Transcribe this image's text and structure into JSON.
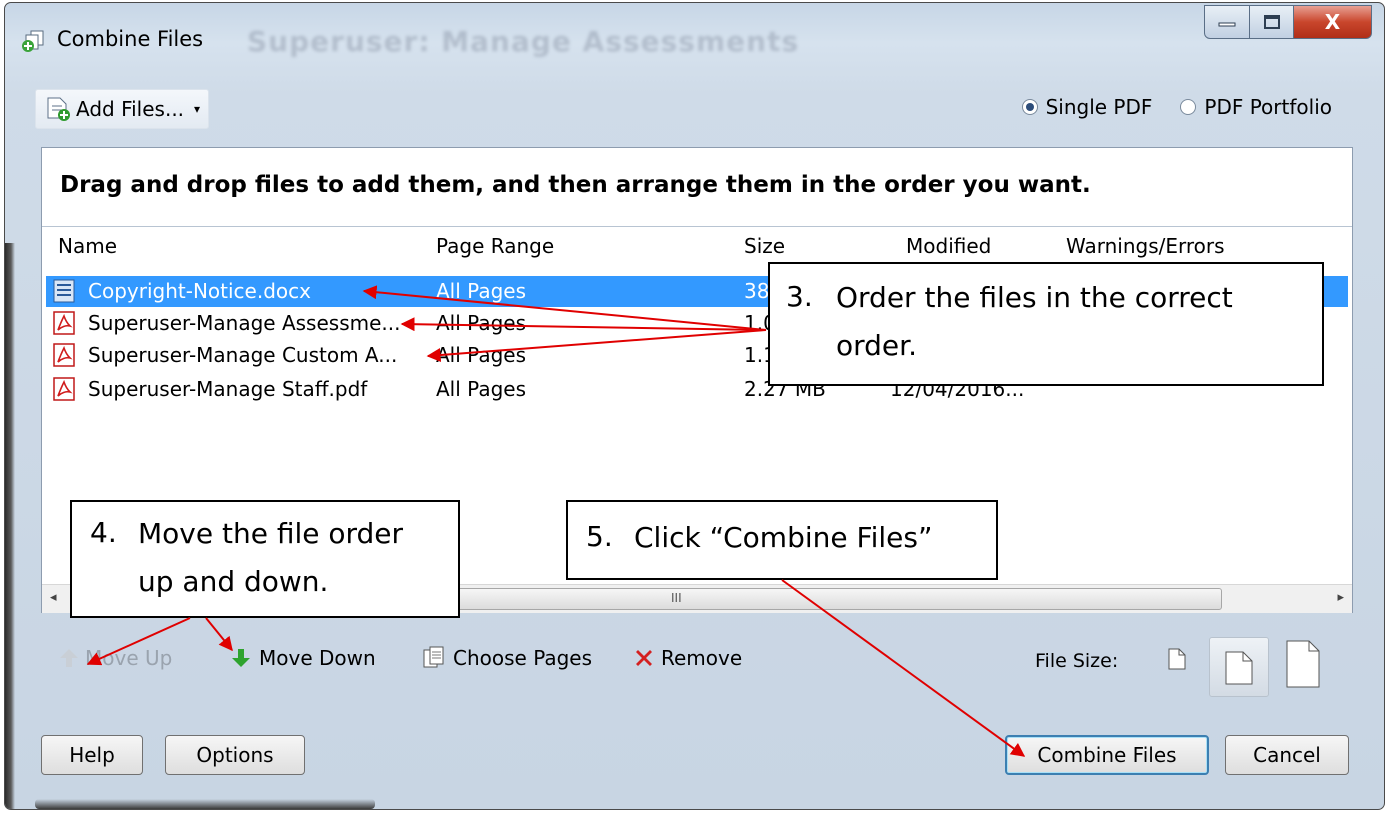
{
  "window": {
    "title": "Combine Files",
    "background_title": "Superuser: Manage Assessments",
    "close_glyph": "X"
  },
  "toolbar": {
    "add_files_label": "Add Files...",
    "add_files_caret": "▾",
    "output_options": [
      {
        "label": "Single PDF",
        "selected": true
      },
      {
        "label": "PDF Portfolio",
        "selected": false
      }
    ]
  },
  "file_list": {
    "instruction": "Drag and drop files to add them, and then arrange them in the order you want.",
    "columns": [
      "Name",
      "Page Range",
      "Size",
      "Modified",
      "Warnings/Errors"
    ],
    "rows": [
      {
        "name": "Copyright-Notice.docx",
        "icon": "word-doc-icon",
        "page_range": "All Pages",
        "size": "38",
        "modified": "",
        "selected": true
      },
      {
        "name": "Superuser-Manage Assessme...",
        "icon": "pdf-icon",
        "page_range": "All Pages",
        "size": "1.0",
        "modified": "",
        "selected": false
      },
      {
        "name": "Superuser-Manage Custom A...",
        "icon": "pdf-icon",
        "page_range": "All Pages",
        "size": "1.1",
        "modified": "",
        "selected": false
      },
      {
        "name": "Superuser-Manage Staff.pdf",
        "icon": "pdf-icon",
        "page_range": "All Pages",
        "size": "2.27 MB",
        "modified": "12/04/2016...",
        "selected": false
      }
    ],
    "scroll_grip": "III"
  },
  "actions": {
    "move_up": "Move Up",
    "move_down": "Move Down",
    "choose_pages": "Choose Pages",
    "remove": "Remove",
    "file_size_label": "File Size:"
  },
  "footer": {
    "help": "Help",
    "options": "Options",
    "combine": "Combine Files",
    "cancel": "Cancel"
  },
  "annotations": {
    "step3": {
      "number": "3.",
      "line1": "Order the files in the correct",
      "line2": "order."
    },
    "step4": {
      "number": "4.",
      "line1": "Move the file order",
      "line2": "up and down."
    },
    "step5": {
      "number": "5.",
      "line1": "Click “Combine Files”"
    },
    "arrow_color": "#e00000"
  }
}
